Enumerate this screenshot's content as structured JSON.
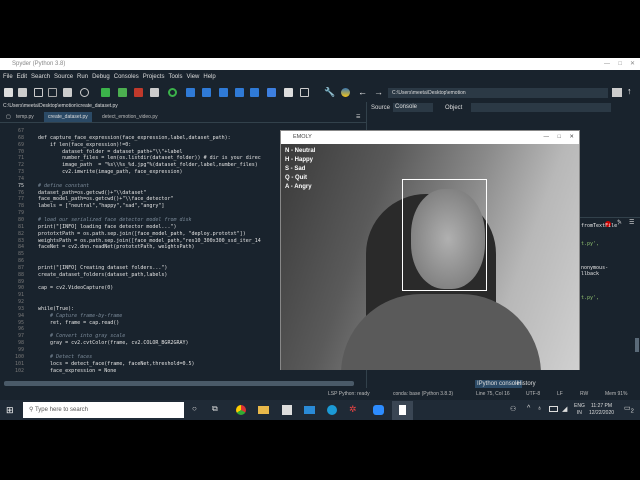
{
  "window_title": "Spyder (Python 3.8)",
  "menu": [
    "File",
    "Edit",
    "Search",
    "Source",
    "Run",
    "Debug",
    "Consoles",
    "Projects",
    "Tools",
    "View",
    "Help"
  ],
  "toolbar_path": "C:\\Users\\meeta\\Desktop\\emotion",
  "file_path": "C:\\Users\\meeta\\Desktop\\emotion\\create_dataset.py",
  "tabs": [
    "temp.py",
    "create_dataset.py",
    "detect_emotion_video.py"
  ],
  "right_pane": {
    "source_label": "Source",
    "source_value": "Console",
    "object_label": "Object"
  },
  "code": [
    {
      "n": "67",
      "t": "",
      "k": ""
    },
    {
      "n": "68",
      "t": "def capture_face_expression(face_expression,label,dataset_path):",
      "k": "n2"
    },
    {
      "n": "69",
      "t": "    if len(face_expression)!=0:",
      "k": "n2"
    },
    {
      "n": "70",
      "t": "        dataset_folder = dataset_path+\"\\\\\"+label",
      "k": "n2"
    },
    {
      "n": "71",
      "t": "        number_files = len(os.listdir(dataset_folder)) # dir is your direc",
      "k": "n2"
    },
    {
      "n": "72",
      "t": "        image_path  = \"%s\\\\%s_%d.jpg\"%(dataset_folder,label,number_files)",
      "k": "n2"
    },
    {
      "n": "73",
      "t": "        cv2.imwrite(image_path, face_expression)",
      "k": "n2"
    },
    {
      "n": "74",
      "t": "",
      "k": ""
    },
    {
      "n": "75",
      "t": "# define constant",
      "k": "c"
    },
    {
      "n": "76",
      "t": "dataset_path=os.getcwd()+\"\\\\dataset\"",
      "k": "n2"
    },
    {
      "n": "77",
      "t": "face_model_path=os.getcwd()+\"\\\\face_detector\"",
      "k": "n2"
    },
    {
      "n": "78",
      "t": "labels = [\"neutral\",\"happy\",\"sad\",\"angry\"]",
      "k": "n2"
    },
    {
      "n": "79",
      "t": "",
      "k": ""
    },
    {
      "n": "80",
      "t": "# load our serialized face detector model from disk",
      "k": "c"
    },
    {
      "n": "81",
      "t": "print(\"[INFO] loading face detector model...\")",
      "k": "n2"
    },
    {
      "n": "82",
      "t": "prototxtPath = os.path.sep.join([face_model_path, \"deploy.prototxt\"])",
      "k": "n2"
    },
    {
      "n": "83",
      "t": "weightsPath = os.path.sep.join([face_model_path,\"res10_300x300_ssd_iter_14",
      "k": "n2"
    },
    {
      "n": "84",
      "t": "faceNet = cv2.dnn.readNet(prototxtPath, weightsPath)",
      "k": "n2"
    },
    {
      "n": "85",
      "t": "",
      "k": ""
    },
    {
      "n": "86",
      "t": "",
      "k": ""
    },
    {
      "n": "87",
      "t": "print(\"[INFO] Creating dataset folders...\")",
      "k": "n2"
    },
    {
      "n": "88",
      "t": "create_dataset_folders(dataset_path,labels)",
      "k": "n2"
    },
    {
      "n": "89",
      "t": "",
      "k": ""
    },
    {
      "n": "90",
      "t": "cap = cv2.VideoCapture(0)",
      "k": "n2"
    },
    {
      "n": "91",
      "t": "",
      "k": ""
    },
    {
      "n": "92",
      "t": "",
      "k": ""
    },
    {
      "n": "93",
      "t": "while(True):",
      "k": "n2"
    },
    {
      "n": "94",
      "t": "    # Capture frame-by-frame",
      "k": "c"
    },
    {
      "n": "95",
      "t": "    ret, frame = cap.read()",
      "k": "n2"
    },
    {
      "n": "96",
      "t": "",
      "k": ""
    },
    {
      "n": "97",
      "t": "    # Convert into gray scale",
      "k": "c"
    },
    {
      "n": "98",
      "t": "    gray = cv2.cvtColor(frame, cv2.COLOR_BGR2GRAY)",
      "k": "n2"
    },
    {
      "n": "99",
      "t": "",
      "k": ""
    },
    {
      "n": "100",
      "t": "    # Detect faces",
      "k": "c"
    },
    {
      "n": "101",
      "t": "    locs = detect_face(frame, faceNet,threshold=0.5)",
      "k": "n2"
    },
    {
      "n": "102",
      "t": "    face_expression = None",
      "k": "n2"
    }
  ],
  "console_fragments": [
    "fromTextFile'",
    "t.py',",
    "nonymous-",
    "llback",
    "t.py',"
  ],
  "console_tabs": [
    "IPython console",
    "History"
  ],
  "emoly": {
    "title": "EMOLY",
    "keys": [
      "N - Neutral",
      "H - Happy",
      "S - Sad",
      "Q - Quit",
      "A - Angry"
    ]
  },
  "status": {
    "lsp": "LSP Python: ready",
    "conda": "conda: base (Python 3.8.3)",
    "position": "Line 75, Col 16",
    "encoding": "UTF-8",
    "eol": "LF",
    "perm": "RW",
    "mem": "Mem 91%"
  },
  "taskbar": {
    "search_placeholder": "Type here to search",
    "lang1": "ENG",
    "lang2": "IN",
    "time": "11:27 PM",
    "date": "12/22/2020",
    "notif": "2"
  }
}
